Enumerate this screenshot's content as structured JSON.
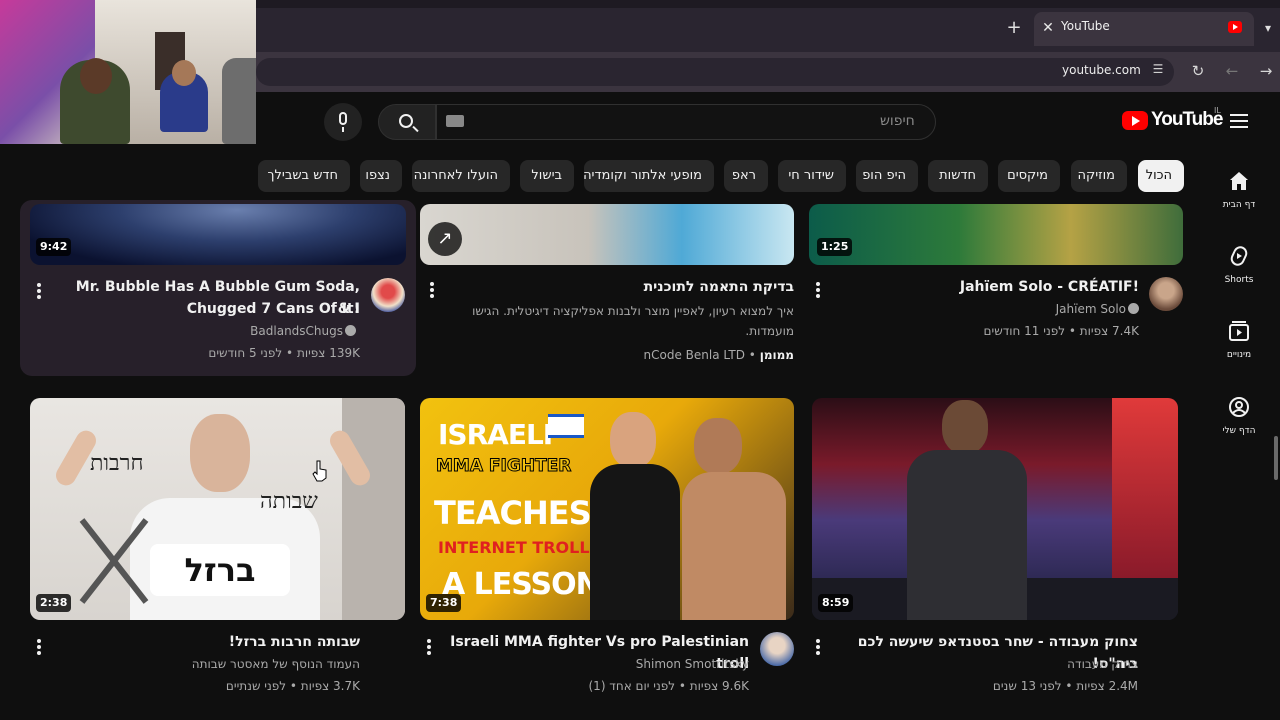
{
  "browser": {
    "tab_title": "YouTube",
    "url": "youtube.com",
    "new_tab": "+",
    "close": "✕"
  },
  "header": {
    "logo_text": "YouTube",
    "logo_country": "IL",
    "search_placeholder": "חיפוש"
  },
  "chips": [
    {
      "label": "הכול",
      "active": true
    },
    {
      "label": "מוזיקה"
    },
    {
      "label": "מיקסים"
    },
    {
      "label": "חדשות"
    },
    {
      "label": "היפ הופ"
    },
    {
      "label": "שידור חי"
    },
    {
      "label": "ראפ"
    },
    {
      "label": "מופעי אלתור וקומדיה"
    },
    {
      "label": "בישול"
    },
    {
      "label": "הועלו לאחרונה"
    },
    {
      "label": "נצפו"
    },
    {
      "label": "חדש בשבילך"
    }
  ],
  "rail": [
    {
      "label": "דף הבית",
      "icon": "home-icon"
    },
    {
      "label": "Shorts",
      "icon": "shorts-icon"
    },
    {
      "label": "מינויים",
      "icon": "subscriptions-icon"
    },
    {
      "label": "הדף שלי",
      "icon": "you-icon"
    }
  ],
  "videos_row1": [
    {
      "title": "Jahïem Solo - CRÉATIF!",
      "channel": "Jahïem Solo",
      "meta": "7.4K צפיות • לפני 11 חודשים",
      "duration": "1:25"
    },
    {
      "title": "בדיקת התאמה לתוכנית",
      "desc_line1": "איך למצוא רעיון, לאפיין מוצר ולבנות אפליקציה דיגיטלית. הגישו",
      "desc_line2": "מועמדות.",
      "sponsored": "ממומן",
      "advertiser": "nCode Benla LTD"
    },
    {
      "title_line1": "Mr. Bubble Has A Bubble Gum Soda, & I",
      "title_line2": "Chugged 7 Cans Of It!",
      "channel": "BadlandsChugs",
      "meta": "139K צפיות • לפני 5 חודשים",
      "duration": "9:42"
    }
  ],
  "videos_row2": [
    {
      "title": "צחוק מעבודה - שחר בסטנדאפ שיעשה לכם ביה\"ס!",
      "channel": "צחוק מעבודה",
      "meta": "2.4M צפיות • לפני 13 שנים",
      "duration": "8:59"
    },
    {
      "title": "Israeli MMA fighter Vs pro Palestinian troll",
      "channel": "Shimon Smotritsky",
      "meta": "9.6K צפיות • לפני יום אחד (1)",
      "duration": "7:38",
      "thumb_text": [
        "ISRAELI",
        "MMA FIGHTER",
        "TEACHES",
        "INTERNET TROLL",
        "A LESSON"
      ]
    },
    {
      "title": "שבותה חרבות ברזל!",
      "channel": "העמוד הנוסף של מאסטר שבותה",
      "meta": "3.7K צפיות • לפני שנתיים",
      "duration": "2:38",
      "thumb_text": [
        "חרבות",
        "שבותה",
        "ברזל"
      ]
    }
  ]
}
